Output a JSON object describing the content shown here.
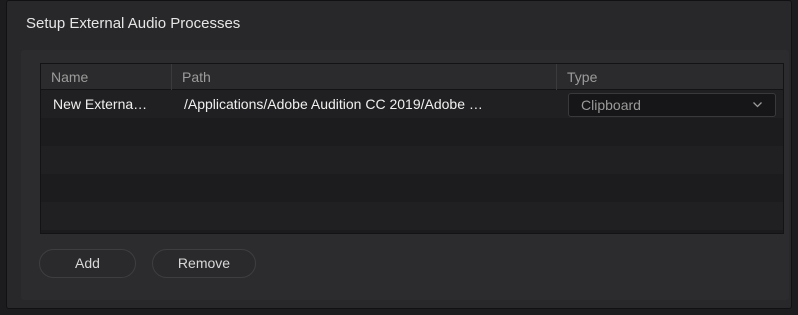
{
  "dialog": {
    "title": "Setup External Audio Processes"
  },
  "table": {
    "columns": [
      "Name",
      "Path",
      "Type"
    ],
    "rows": [
      {
        "name": "New Externa…",
        "path": "/Applications/Adobe Audition CC 2019/Adobe …",
        "type": "Clipboard"
      }
    ]
  },
  "buttons": {
    "add": "Add",
    "remove": "Remove"
  },
  "icons": {
    "type_dropdown": "chevron-down-icon"
  },
  "colors": {
    "window_bg": "#28282a",
    "table_bg": "#1b1b1d",
    "text": "#f0f0f0",
    "muted_text": "#9c9c9c"
  }
}
